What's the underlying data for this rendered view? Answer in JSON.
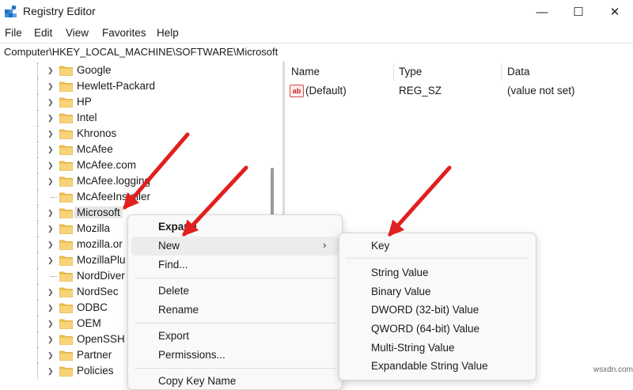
{
  "window": {
    "title": "Registry Editor",
    "minimize_glyph": "—",
    "maximize_glyph": "☐",
    "close_glyph": "✕"
  },
  "menubar": {
    "items": [
      "File",
      "Edit",
      "View",
      "Favorites",
      "Help"
    ]
  },
  "address": {
    "path": "Computer\\HKEY_LOCAL_MACHINE\\SOFTWARE\\Microsoft"
  },
  "tree": {
    "items": [
      {
        "label": "Google",
        "expandable": true
      },
      {
        "label": "Hewlett-Packard",
        "expandable": true
      },
      {
        "label": "HP",
        "expandable": true
      },
      {
        "label": "Intel",
        "expandable": true
      },
      {
        "label": "Khronos",
        "expandable": true
      },
      {
        "label": "McAfee",
        "expandable": true
      },
      {
        "label": "McAfee.com",
        "expandable": true
      },
      {
        "label": "McAfee.logging",
        "expandable": true
      },
      {
        "label": "McAfeeInstaller",
        "expandable": false
      },
      {
        "label": "Microsoft",
        "expandable": true,
        "selected": true
      },
      {
        "label": "Mozilla",
        "expandable": true
      },
      {
        "label": "mozilla.or",
        "expandable": true
      },
      {
        "label": "MozillaPlu",
        "expandable": true
      },
      {
        "label": "NordDiver",
        "expandable": false
      },
      {
        "label": "NordSec",
        "expandable": true
      },
      {
        "label": "ODBC",
        "expandable": true
      },
      {
        "label": "OEM",
        "expandable": true
      },
      {
        "label": "OpenSSH",
        "expandable": true
      },
      {
        "label": "Partner",
        "expandable": true
      },
      {
        "label": "Policies",
        "expandable": true
      }
    ]
  },
  "list": {
    "columns": [
      "Name",
      "Type",
      "Data"
    ],
    "rows": [
      {
        "name": "(Default)",
        "type": "REG_SZ",
        "data": "(value not set)",
        "icon": "string-value-icon"
      }
    ]
  },
  "context_menu": {
    "items": {
      "expand": "Expand",
      "new": "New",
      "find": "Find...",
      "delete": "Delete",
      "rename": "Rename",
      "export": "Export",
      "permissions": "Permissions...",
      "copy_key_name": "Copy Key Name"
    },
    "submenu_chevron": "›"
  },
  "new_submenu": {
    "items": {
      "key": "Key",
      "string_value": "String Value",
      "binary_value": "Binary Value",
      "dword_value": "DWORD (32-bit) Value",
      "qword_value": "QWORD (64-bit) Value",
      "multi_string_value": "Multi-String Value",
      "expandable_string_value": "Expandable String Value"
    }
  },
  "watermark": "wsxdn.com",
  "colors": {
    "annotation_arrow": "#e0201e",
    "folder": "#f2c14e",
    "selection": "#e5e5e5"
  }
}
